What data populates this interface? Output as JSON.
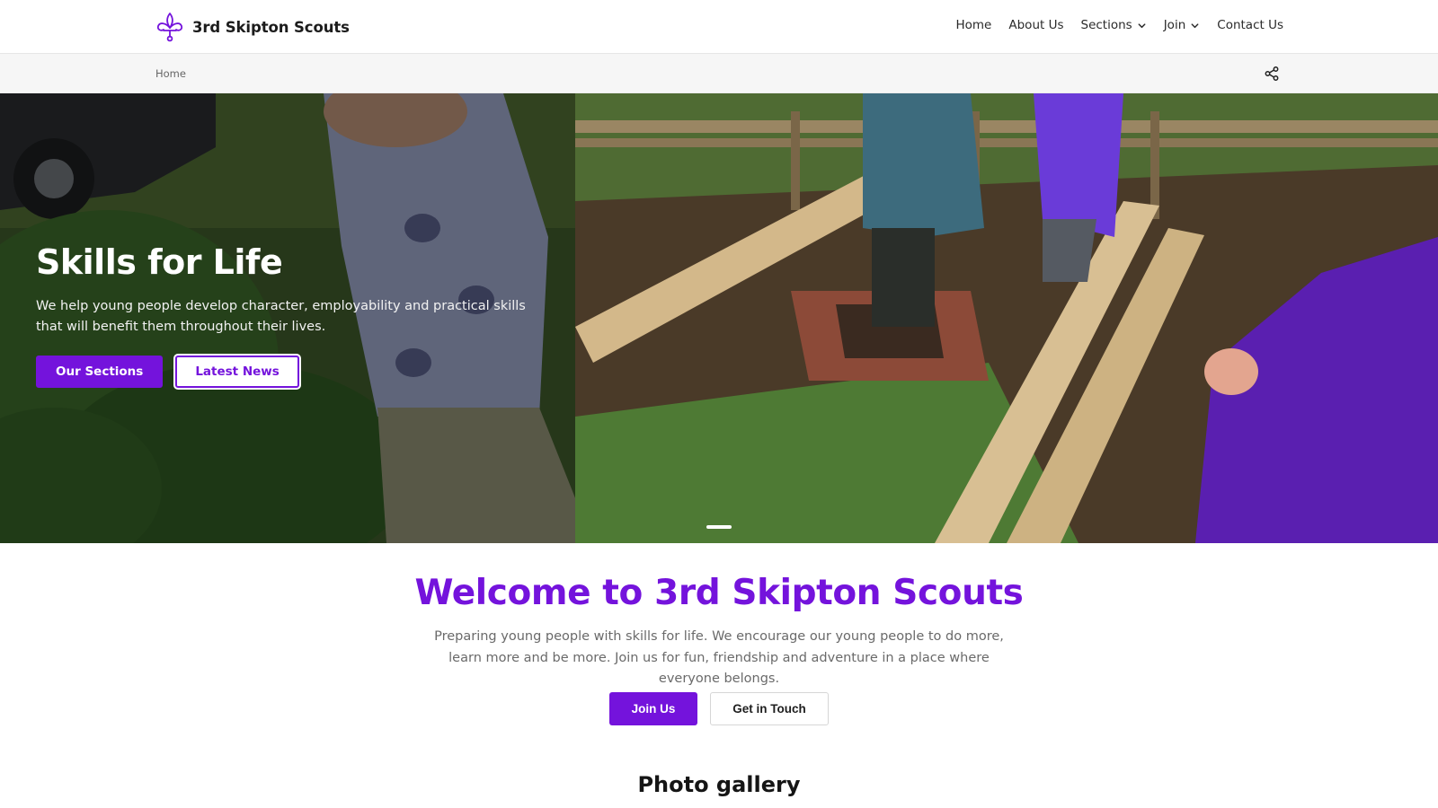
{
  "header": {
    "brand_name": "3rd Skipton Scouts",
    "logo_icon": "fleur-de-lis-icon",
    "nav": [
      {
        "label": "Home",
        "dropdown": false
      },
      {
        "label": "About Us",
        "dropdown": false
      },
      {
        "label": "Sections",
        "dropdown": true
      },
      {
        "label": "Join",
        "dropdown": true
      },
      {
        "label": "Contact Us",
        "dropdown": false
      }
    ]
  },
  "breadcrumb": {
    "items": [
      "Home"
    ],
    "share_icon": "share-icon"
  },
  "hero": {
    "title": "Skills for Life",
    "text": "We help young people develop character, employability and practical skills that will benefit them throughout their lives.",
    "primary_button": "Our Sections",
    "secondary_button": "Latest News",
    "slide_count": 1,
    "active_slide": 1
  },
  "welcome": {
    "title": "Welcome to 3rd Skipton Scouts",
    "text": "Preparing young people with skills for life. We encourage our young people to do more, learn more and be more. Join us for fun, friendship and adventure in a place where everyone belongs.",
    "join_button": "Join Us",
    "touch_button": "Get in Touch"
  },
  "gallery": {
    "title": "Photo gallery"
  },
  "colors": {
    "accent": "#7413dc",
    "text_dark": "#1c1c1c",
    "text_muted": "#6a6a6a",
    "breadcrumb_bg": "#f6f6f6"
  }
}
